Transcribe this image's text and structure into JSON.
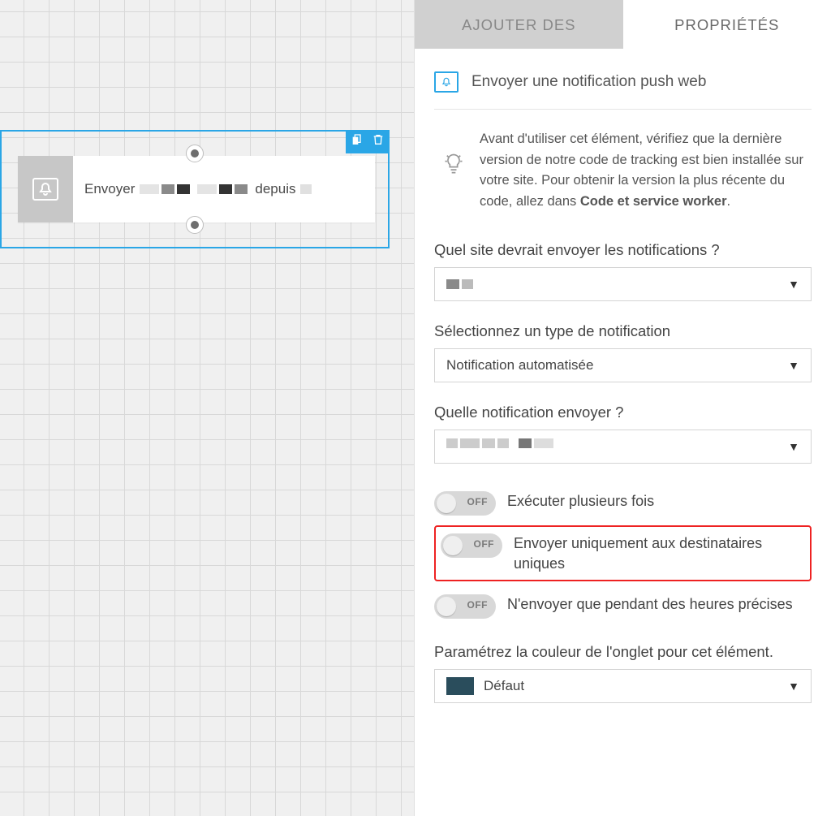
{
  "tabs": {
    "add": "AJOUTER DES",
    "props": "PROPRIÉTÉS"
  },
  "canvas_node": {
    "word1": "Envoyer",
    "word2": "depuis"
  },
  "element": {
    "title": "Envoyer une notification push web"
  },
  "help": {
    "text_before": "Avant d'utiliser cet élément, vérifiez que la dernière version de notre code de tracking est bien installée sur votre site. Pour obtenir la version la plus récente du code, allez dans ",
    "text_bold": "Code et service worker",
    "text_after": "."
  },
  "fields": {
    "site_label": "Quel site devrait envoyer les notifications ?",
    "type_label": "Sélectionnez un type de notification",
    "type_value": "Notification automatisée",
    "which_label": "Quelle notification envoyer ?",
    "color_label": "Paramétrez la couleur de l'onglet pour cet élément.",
    "color_value": "Défaut"
  },
  "toggles": {
    "off": "OFF",
    "multi": "Exécuter plusieurs fois",
    "unique": "Envoyer uniquement aux destinataires uniques",
    "hours": "N'envoyer que pendant des heures précises"
  }
}
